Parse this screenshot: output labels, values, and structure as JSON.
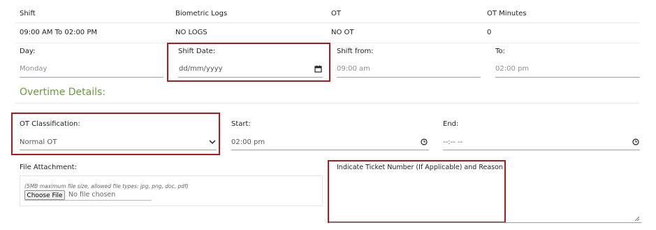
{
  "table": {
    "headers": [
      "Shift",
      "Biometric Logs",
      "OT",
      "OT Minutes"
    ],
    "row": [
      "09:00 AM To 02:00 PM",
      "NO LOGS",
      "NO OT",
      "0"
    ]
  },
  "day": {
    "label": "Day:",
    "value": "Monday"
  },
  "shift_date": {
    "label": "Shift Date:",
    "placeholder": "dd/mm/yyyy"
  },
  "shift_from": {
    "label": "Shift from:",
    "value": "09:00 am"
  },
  "shift_to": {
    "label": "To:",
    "value": "02:00 pm"
  },
  "overtime": {
    "title": "Overtime Details:"
  },
  "ot_classification": {
    "label": "OT Classification:",
    "selected": "Normal OT"
  },
  "start": {
    "label": "Start:",
    "value": "02:00 pm"
  },
  "end": {
    "label": "End:",
    "value": "--:-- --"
  },
  "file_attachment": {
    "label": "File Attachment:",
    "hint": "(5MB maximum file size, allowed file types: jpg, png, doc, pdf)",
    "button": "Choose File",
    "status": "No file chosen"
  },
  "reason": {
    "label": "Indicate Ticket Number (If Applicable) and Reason"
  },
  "colors": {
    "highlight": "#b0191e",
    "section_title": "#6a9a3a"
  },
  "icons": {
    "date": "calendar-icon",
    "time": "clock-icon",
    "dropdown": "chevron-down-icon",
    "resize": "resize-grip-icon"
  }
}
